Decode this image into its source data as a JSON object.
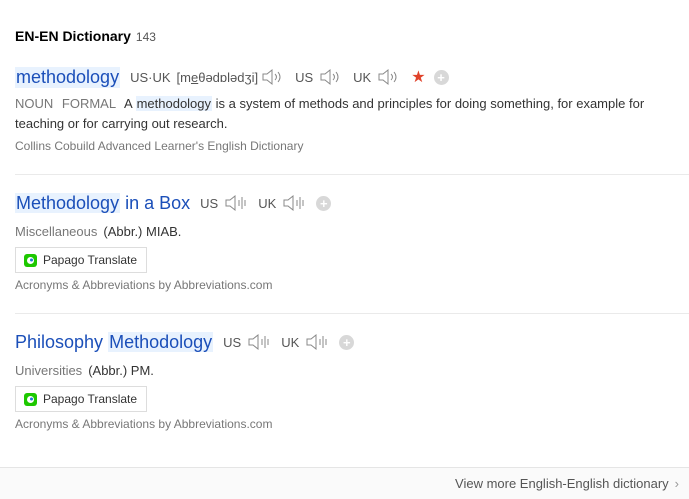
{
  "header": {
    "title": "EN-EN Dictionary",
    "count": "143"
  },
  "entries": [
    {
      "word": "methodology",
      "pron_label": "US·UK",
      "ipa": "[meθədɒlədʒi]",
      "us_label": "US",
      "uk_label": "UK",
      "starred": true,
      "pos": "NOUN",
      "register": "FORMAL",
      "def_pre": "A",
      "def_word": "methodology",
      "def_post": "is a system of methods and principles for doing something, for example for teaching or for carrying out research.",
      "source": "Collins Cobuild Advanced Learner's English Dictionary"
    },
    {
      "word_a": "Methodology",
      "word_b": "in a Box",
      "us_label": "US",
      "uk_label": "UK",
      "category": "Miscellaneous",
      "abbr": "(Abbr.) MIAB.",
      "papago": "Papago Translate",
      "source": "Acronyms & Abbreviations by Abbreviations.com"
    },
    {
      "word_a": "Philosophy",
      "word_b": "Methodology",
      "us_label": "US",
      "uk_label": "UK",
      "category": "Universities",
      "abbr": "(Abbr.) PM.",
      "papago": "Papago Translate",
      "source": "Acronyms & Abbreviations by Abbreviations.com"
    }
  ],
  "footer": {
    "more": "View more English-English dictionary"
  },
  "colors": {
    "link": "#1b4fb9",
    "highlight": "#e8f2fe",
    "star": "#e0432b"
  },
  "icons": [
    "speaker-icon",
    "speaker-wave-icon",
    "star-icon",
    "plus-icon",
    "papago-icon",
    "chevron-right-icon"
  ]
}
